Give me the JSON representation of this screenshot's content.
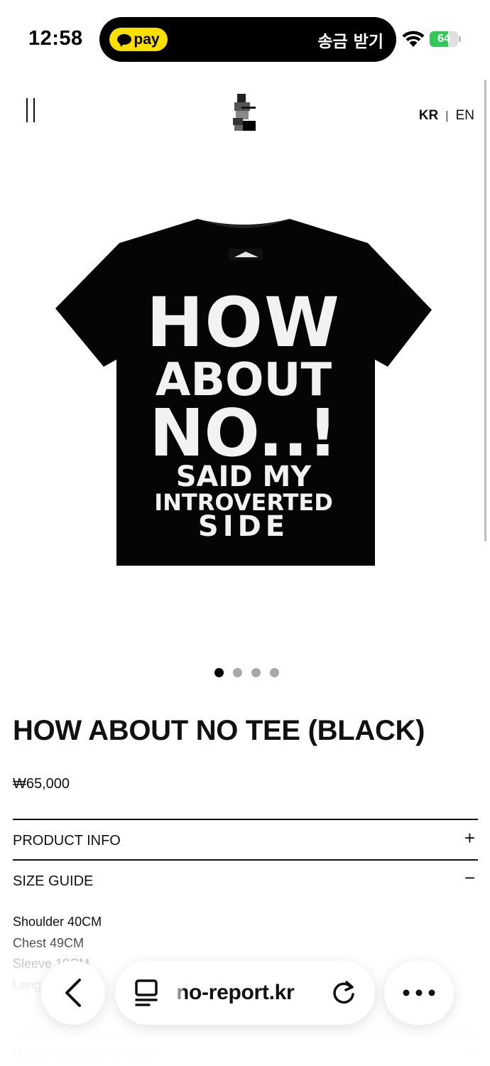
{
  "status_bar": {
    "time": "12:58",
    "pay_label": "pay",
    "island_action": "송금 받기",
    "battery_level": "64",
    "battery_fraction": 0.64,
    "battery_color": "#34c759",
    "pay_color": "#f9e000"
  },
  "header": {
    "menu_icon": "menu-icon",
    "logo_icon": "brand-logo",
    "lang_kr": "KR",
    "lang_sep": "|",
    "lang_en": "EN"
  },
  "product": {
    "image_icon": "black-tshirt",
    "shirt_print": [
      "HOW",
      "ABOUT",
      "NO..!",
      "SAID MY",
      "INTROVERTED",
      "SIDE"
    ],
    "title": "HOW ABOUT NO TEE (BLACK)",
    "price": "₩65,000",
    "carousel_count": 4,
    "carousel_active": 0
  },
  "accordion": {
    "product_info": {
      "label": "PRODUCT INFO",
      "sign": "+"
    },
    "size_guide": {
      "label": "SIZE GUIDE",
      "sign": "−",
      "lines": [
        "Shoulder 40CM",
        "Chest 49CM",
        "Sleeve 18CM",
        "Leng"
      ]
    },
    "return_exchange": {
      "label": "RETURN/EXCHANGE",
      "sign": "+"
    }
  },
  "browser_bar": {
    "url": "no-report.kr",
    "back_icon": "chevron-left-icon",
    "reader_icon": "reader-icon",
    "reload_icon": "reload-icon",
    "more_icon": "more-icon"
  }
}
